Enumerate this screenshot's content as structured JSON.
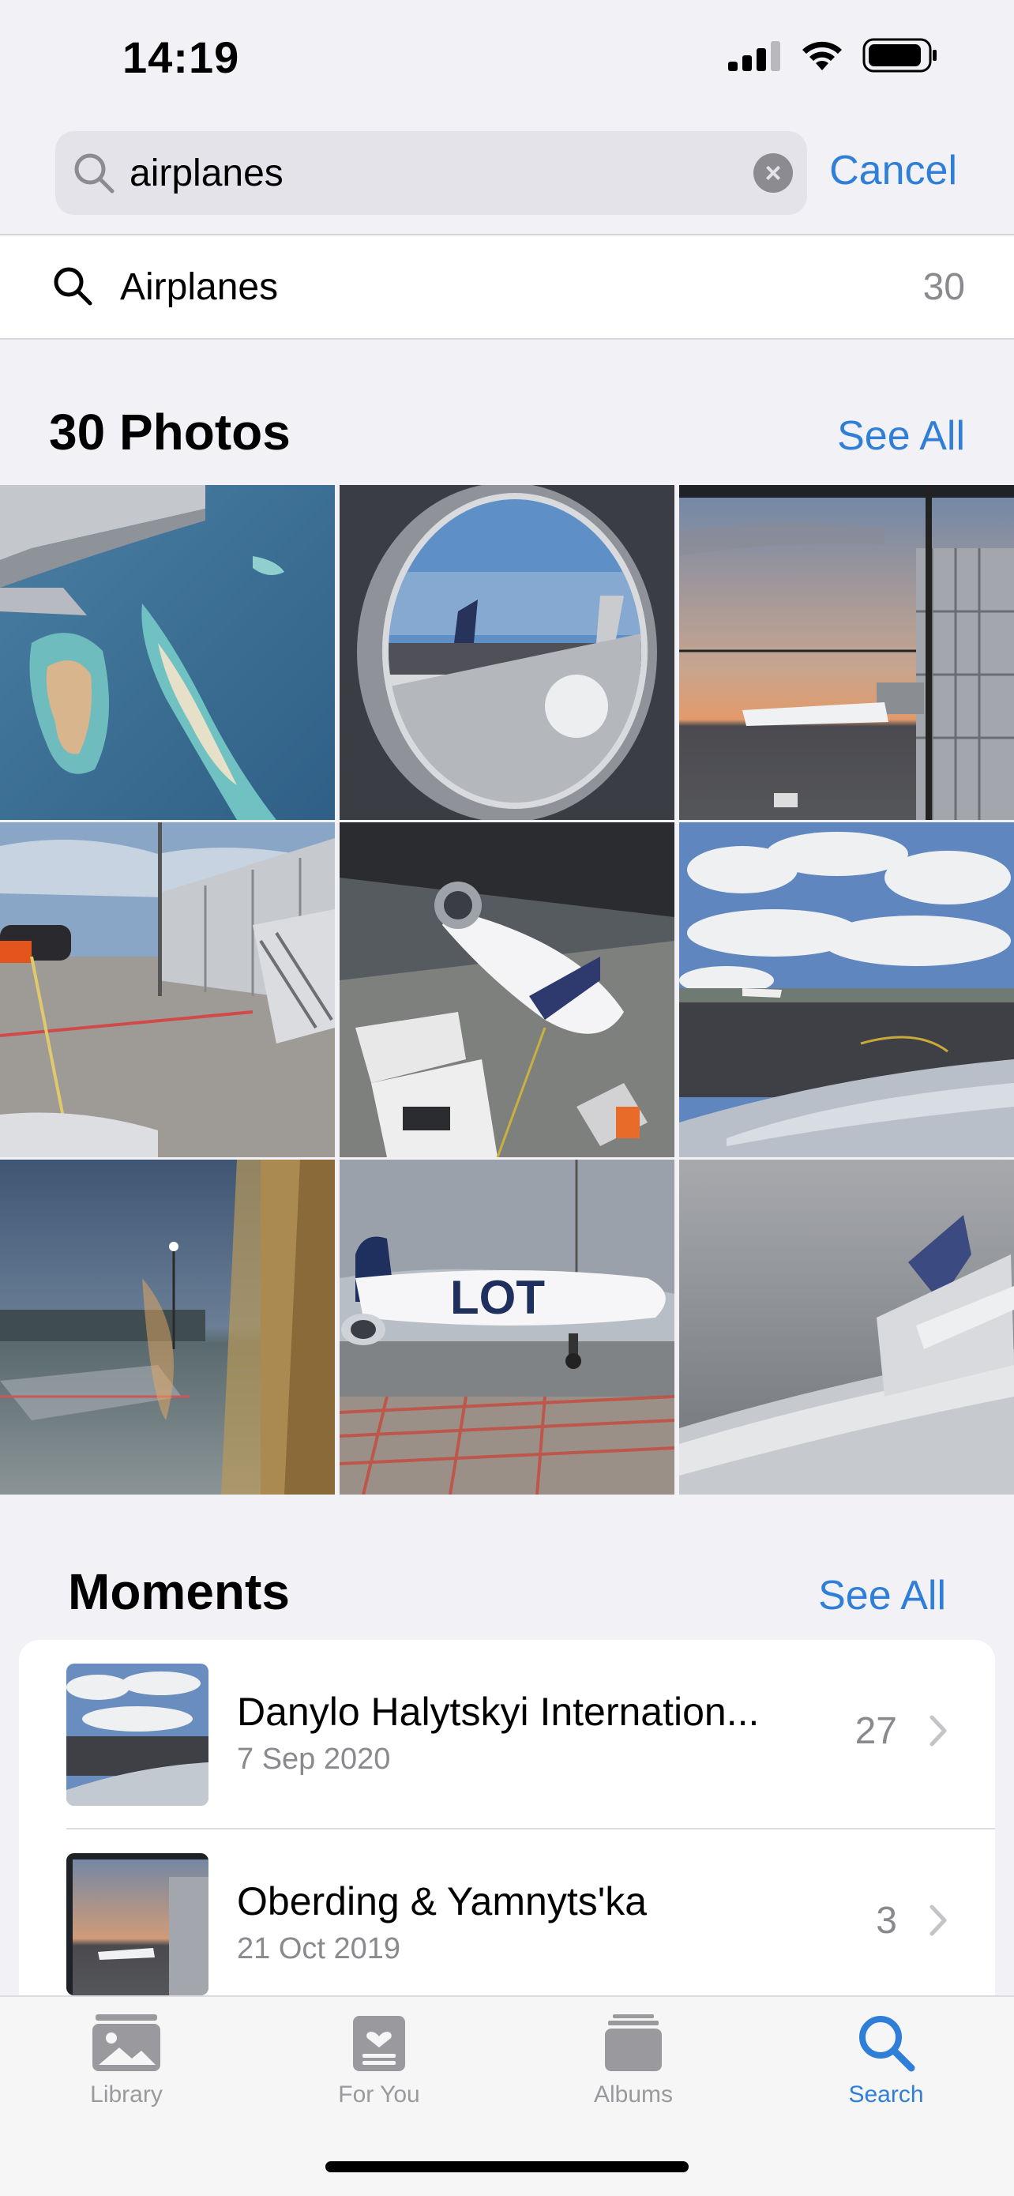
{
  "status_bar": {
    "time": "14:19"
  },
  "search": {
    "value": "airplanes",
    "cancel_label": "Cancel"
  },
  "suggestion": {
    "label": "Airplanes",
    "count": "30"
  },
  "photos_section": {
    "title": "30 Photos",
    "see_all": "See All",
    "photos": [
      "aerial-islands-from-wing",
      "airplane-window-wing",
      "terminal-sunset-jet-bridge",
      "apron-stairs-terminal",
      "widebody-night-gate",
      "cloudy-tarmac-wingtip",
      "dusk-apron-window",
      "lot-dreamliner-apron",
      "wing-in-fog"
    ]
  },
  "moments_section": {
    "title": "Moments",
    "see_all": "See All",
    "items": [
      {
        "title": "Danylo Halytskyi Internation...",
        "date": "7 Sep 2020",
        "count": "27"
      },
      {
        "title": "Oberding & Yamnyts'ka",
        "date": "21 Oct 2019",
        "count": "3"
      }
    ]
  },
  "tabbar": {
    "tabs": [
      {
        "label": "Library",
        "icon": "photos-library-icon",
        "active": false
      },
      {
        "label": "For You",
        "icon": "for-you-icon",
        "active": false
      },
      {
        "label": "Albums",
        "icon": "albums-icon",
        "active": false
      },
      {
        "label": "Search",
        "icon": "search-icon",
        "active": true
      }
    ]
  },
  "colors": {
    "accent": "#2f7fd8",
    "background": "#f2f1f6",
    "secondary_text": "#8a8a8e"
  }
}
